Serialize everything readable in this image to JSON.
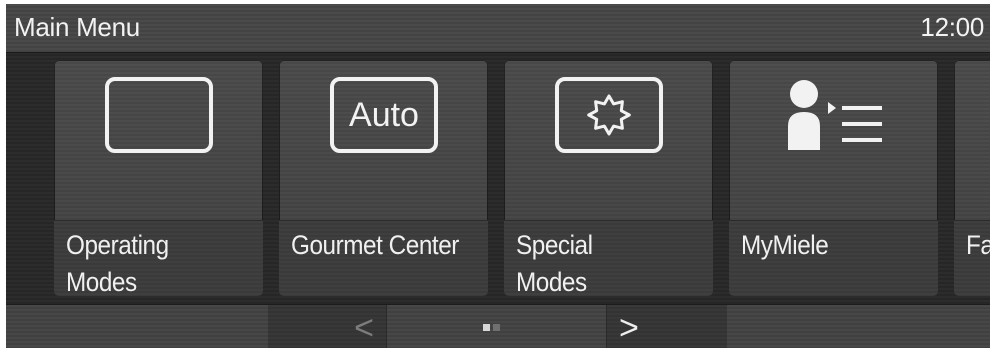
{
  "header": {
    "title": "Main Menu",
    "time": "12:00"
  },
  "tiles": [
    {
      "label": "Operating\nModes",
      "icon": "blank-rectangle-icon"
    },
    {
      "label": "Gourmet Center",
      "icon": "auto-icon",
      "icon_text": "Auto"
    },
    {
      "label": "Special\nModes",
      "icon": "starburst-icon"
    },
    {
      "label": "MyMiele",
      "icon": "person-list-icon"
    },
    {
      "label": "Fa"
    }
  ],
  "nav": {
    "prev": "<",
    "next": ">",
    "pages": 2,
    "current_page": 1
  },
  "colors": {
    "background": "#2c2c2c",
    "tile": "#484848",
    "text": "#f0f0f0",
    "disabled": "#7c7c7c"
  }
}
